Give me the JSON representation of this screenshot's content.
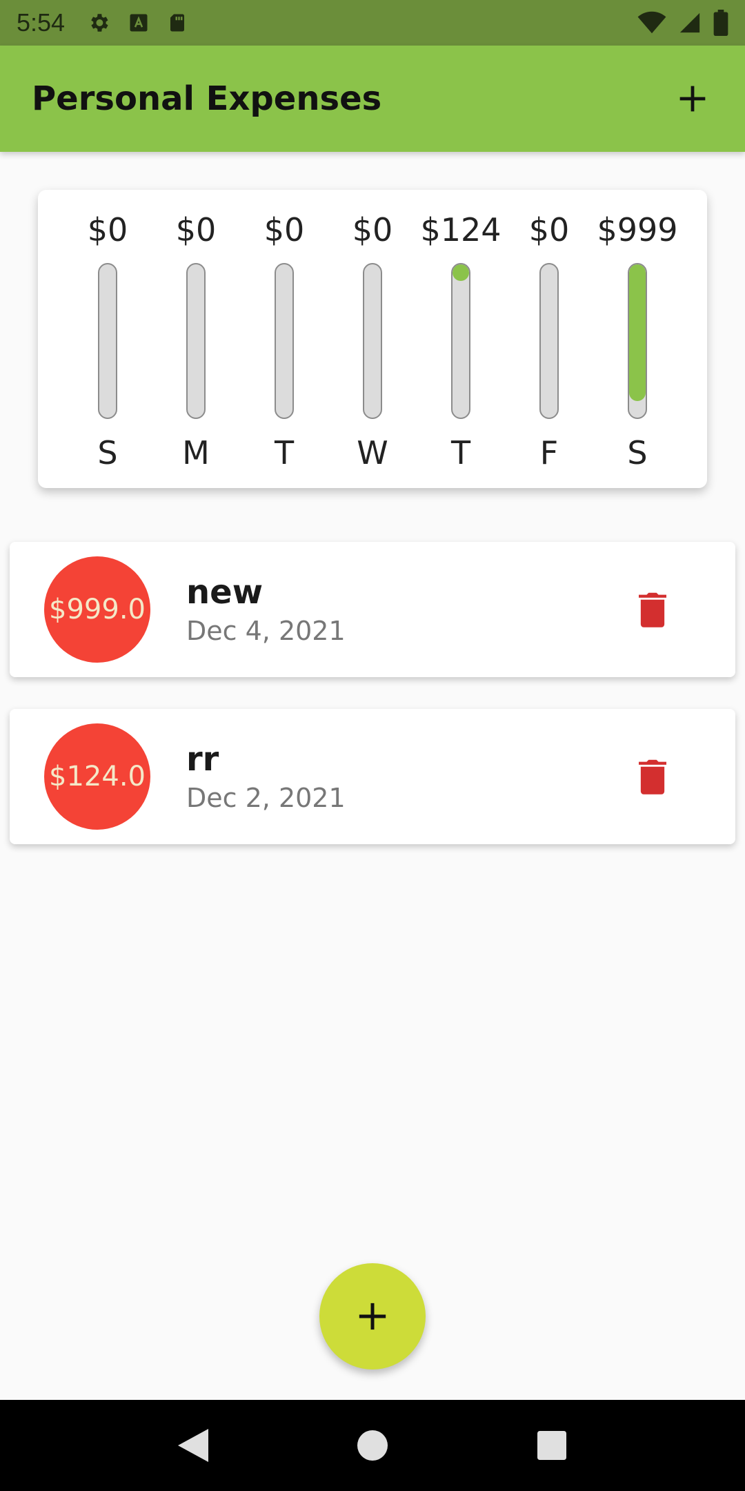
{
  "status_bar": {
    "time": "5:54",
    "left_icons": [
      "gear-icon",
      "text-a-icon",
      "sd-card-icon"
    ],
    "right_icons": [
      "wifi-icon",
      "signal-icon",
      "battery-icon"
    ]
  },
  "app_bar": {
    "title": "Personal Expenses",
    "add_icon": "plus-icon",
    "background": "#8bc34a"
  },
  "chart_data": {
    "type": "bar",
    "categories": [
      "S",
      "M",
      "T",
      "W",
      "T",
      "F",
      "S"
    ],
    "values": [
      0,
      0,
      0,
      0,
      124,
      0,
      999
    ],
    "labels": [
      "$0",
      "$0",
      "$0",
      "$0",
      "$124",
      "$0",
      "$999"
    ],
    "fill_fraction": [
      0,
      0,
      0,
      0,
      0.11,
      0,
      0.89
    ],
    "fill_color": "#8bc34a",
    "track_color": "#dcdcdc"
  },
  "expenses": [
    {
      "amount": "$999.0",
      "title": "new",
      "date": "Dec 4, 2021",
      "delete_icon": "trash-icon"
    },
    {
      "amount": "$124.0",
      "title": "rr",
      "date": "Dec 2, 2021",
      "delete_icon": "trash-icon"
    }
  ],
  "colors": {
    "amount_circle": "#f44336",
    "delete": "#d32f2f",
    "fab": "#cddc39"
  },
  "fab": {
    "icon": "plus-icon"
  },
  "nav_bar": {
    "buttons": [
      "back-icon",
      "home-icon",
      "recents-icon"
    ]
  }
}
